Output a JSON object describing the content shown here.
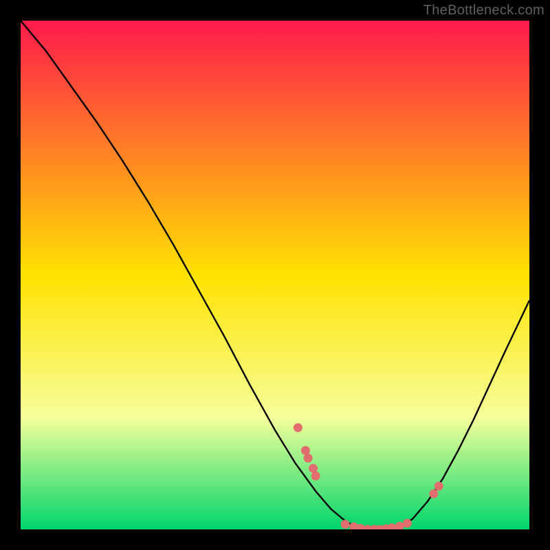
{
  "brand": "TheBottleneck.com",
  "colors": {
    "gradient_top": "#ff1a4b",
    "gradient_mid": "#ffe200",
    "gradient_low": "#f6ff9a",
    "gradient_bottom": "#00d56a",
    "curve": "#000000",
    "marker": "#e06e6e",
    "bg": "#000000"
  },
  "chart_data": {
    "type": "line",
    "title": "",
    "xlabel": "",
    "ylabel": "",
    "xlim": [
      0,
      1
    ],
    "ylim": [
      0,
      1
    ],
    "curve": [
      {
        "x": 0.0,
        "y": 1.0
      },
      {
        "x": 0.05,
        "y": 0.94
      },
      {
        "x": 0.1,
        "y": 0.87
      },
      {
        "x": 0.15,
        "y": 0.8
      },
      {
        "x": 0.2,
        "y": 0.725
      },
      {
        "x": 0.25,
        "y": 0.645
      },
      {
        "x": 0.3,
        "y": 0.56
      },
      {
        "x": 0.35,
        "y": 0.47
      },
      {
        "x": 0.4,
        "y": 0.38
      },
      {
        "x": 0.45,
        "y": 0.285
      },
      {
        "x": 0.5,
        "y": 0.195
      },
      {
        "x": 0.54,
        "y": 0.13
      },
      {
        "x": 0.58,
        "y": 0.075
      },
      {
        "x": 0.61,
        "y": 0.04
      },
      {
        "x": 0.64,
        "y": 0.015
      },
      {
        "x": 0.665,
        "y": 0.003
      },
      {
        "x": 0.69,
        "y": 0.0
      },
      {
        "x": 0.715,
        "y": 0.001
      },
      {
        "x": 0.74,
        "y": 0.004
      },
      {
        "x": 0.77,
        "y": 0.02
      },
      {
        "x": 0.8,
        "y": 0.055
      },
      {
        "x": 0.83,
        "y": 0.1
      },
      {
        "x": 0.86,
        "y": 0.155
      },
      {
        "x": 0.89,
        "y": 0.215
      },
      {
        "x": 0.92,
        "y": 0.28
      },
      {
        "x": 0.95,
        "y": 0.345
      },
      {
        "x": 0.98,
        "y": 0.408
      },
      {
        "x": 1.0,
        "y": 0.45
      }
    ],
    "markers": [
      {
        "x": 0.545,
        "y": 0.2
      },
      {
        "x": 0.56,
        "y": 0.155
      },
      {
        "x": 0.565,
        "y": 0.14
      },
      {
        "x": 0.575,
        "y": 0.12
      },
      {
        "x": 0.58,
        "y": 0.105
      },
      {
        "x": 0.638,
        "y": 0.01
      },
      {
        "x": 0.655,
        "y": 0.005
      },
      {
        "x": 0.668,
        "y": 0.002
      },
      {
        "x": 0.682,
        "y": 0.0
      },
      {
        "x": 0.695,
        "y": 0.0
      },
      {
        "x": 0.706,
        "y": 0.0
      },
      {
        "x": 0.718,
        "y": 0.001
      },
      {
        "x": 0.73,
        "y": 0.003
      },
      {
        "x": 0.745,
        "y": 0.006
      },
      {
        "x": 0.76,
        "y": 0.012
      },
      {
        "x": 0.812,
        "y": 0.07
      },
      {
        "x": 0.822,
        "y": 0.085
      }
    ]
  }
}
